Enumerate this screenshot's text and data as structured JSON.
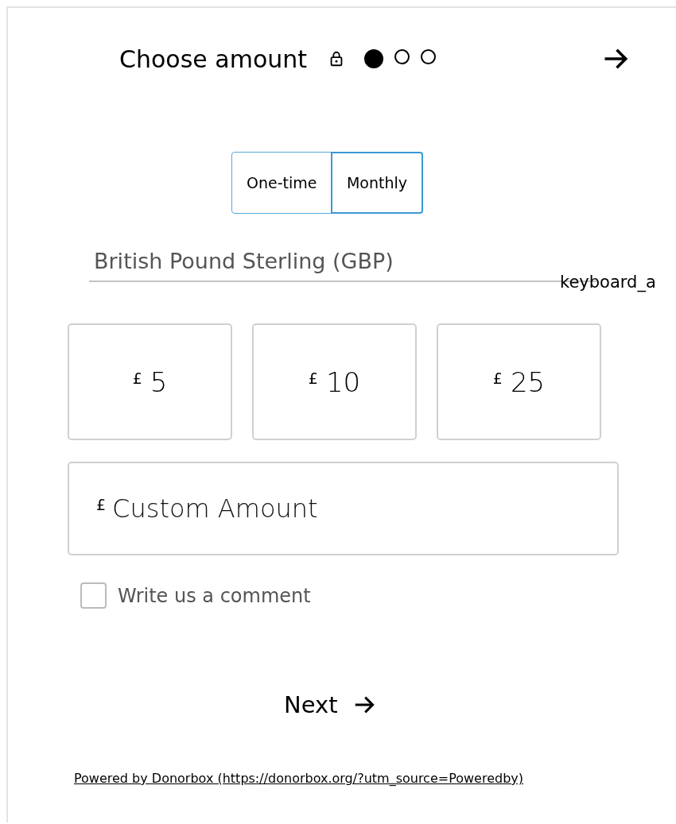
{
  "header": {
    "title": "Choose amount",
    "steps": [
      {
        "selected": true
      },
      {
        "selected": false
      },
      {
        "selected": false
      }
    ]
  },
  "frequency_tabs": [
    {
      "label": "One-time",
      "selected": false
    },
    {
      "label": "Monthly",
      "selected": true
    }
  ],
  "currency_select": {
    "value": "British Pound Sterling (GBP)",
    "icon_text": "keyboard_a"
  },
  "amounts": [
    {
      "symbol": "£",
      "value": "5"
    },
    {
      "symbol": "£",
      "value": "10"
    },
    {
      "symbol": "£",
      "value": "25"
    }
  ],
  "custom_amount": {
    "symbol": "£",
    "placeholder": "Custom Amount"
  },
  "comment_option": {
    "label": "Write us a comment",
    "checked": false
  },
  "next_button": {
    "label": "Next"
  },
  "footer_link": "Powered by Donorbox (https://donorbox.org/?utm_source=Poweredby)"
}
